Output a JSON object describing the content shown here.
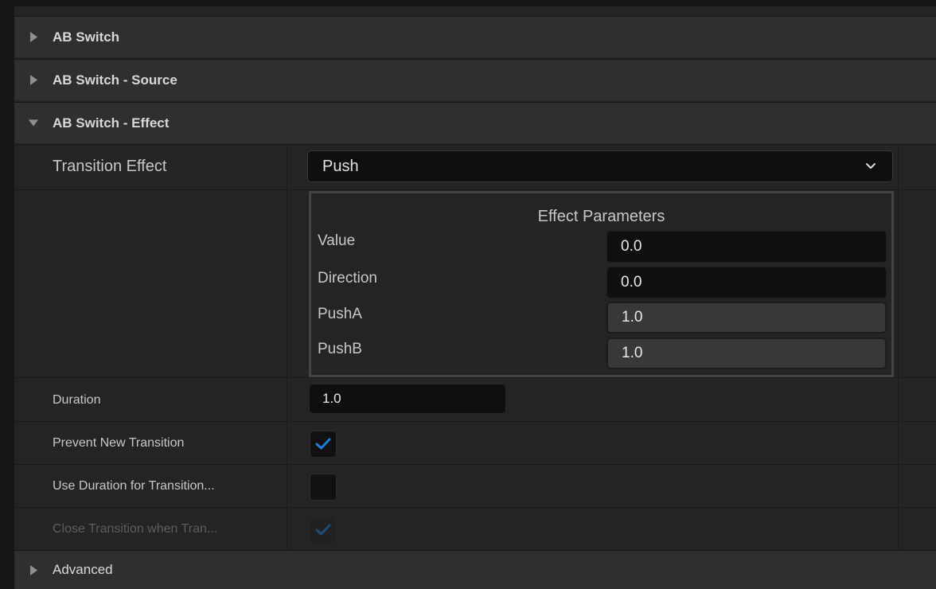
{
  "categories": {
    "ab_switch": "AB Switch",
    "ab_switch_source": "AB Switch - Source",
    "ab_switch_effect": "AB Switch - Effect",
    "advanced": "Advanced"
  },
  "transition_effect": {
    "label": "Transition Effect",
    "value": "Push"
  },
  "effect_parameters": {
    "title": "Effect Parameters",
    "params": [
      {
        "label": "Value",
        "value": "0.0"
      },
      {
        "label": "Direction",
        "value": "0.0"
      },
      {
        "label": "PushA",
        "value": "1.0"
      },
      {
        "label": "PushB",
        "value": "1.0"
      }
    ]
  },
  "duration": {
    "label": "Duration",
    "value": "1.0"
  },
  "prevent_new_transition": {
    "label": "Prevent New Transition",
    "checked": true
  },
  "use_duration": {
    "label": "Use Duration for Transition...",
    "checked": false
  },
  "close_transition": {
    "label": "Close Transition when Tran...",
    "checked": true,
    "disabled": true
  },
  "colors": {
    "accent": "#1a7fe0",
    "panel_bg": "#242424",
    "category_bg": "#2f2f2f",
    "field_bg": "#0f0f0f"
  },
  "icons": {
    "collapsed": "triangle-right-icon",
    "expanded": "triangle-down-icon",
    "dropdown": "chevron-down-icon",
    "check": "checkmark-icon"
  }
}
